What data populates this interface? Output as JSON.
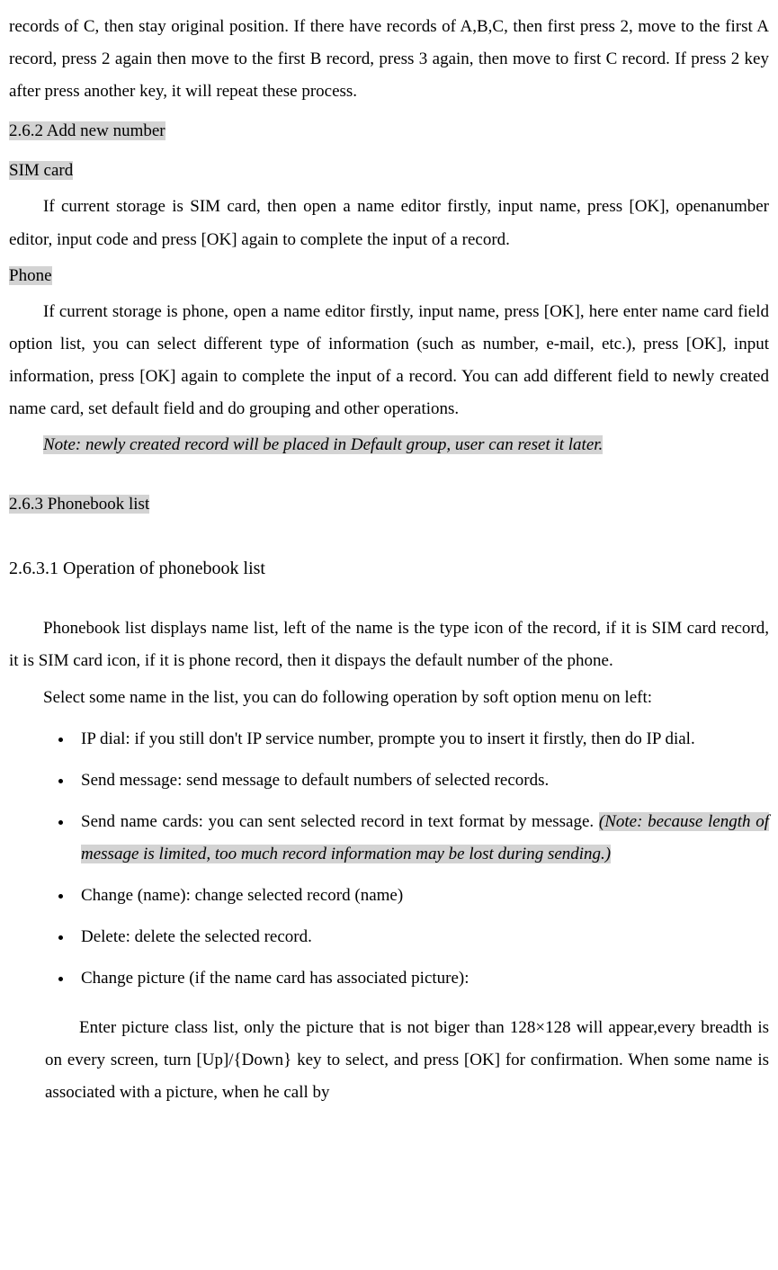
{
  "top_paragraph": "records of C, then stay original position. If there have records of A,B,C, then first press 2, move to the first A record, press 2 again then move to the first B record, press 3 again, then move to first C record. If press 2 key after press another key, it will repeat these process.",
  "sec262": {
    "heading": "2.6.2 Add new number",
    "sim_label": "SIM card",
    "sim_text": "If current storage is SIM card, then open a name editor firstly, input name, press [OK], openanumber editor, input code and press [OK] again to complete the input of a record.",
    "phone_label": "Phone",
    "phone_text": "If current storage is phone, open a name editor firstly, input name, press [OK], here enter name card field option list, you can select different type of information (such as number, e-mail, etc.), press [OK], input information, press [OK] again to complete the input of a record. You can add different field to newly created name card, set default field and do grouping and other operations.",
    "note": "Note: newly created record will be placed in Default group, user can reset it later."
  },
  "sec263": {
    "heading": "2.6.3 Phonebook list",
    "sub_heading": "2.6.3.1 Operation of phonebook list",
    "intro": "Phonebook list displays name list, left of the name is the type icon of the record, if it is SIM card record, it is SIM card icon, if it is phone record, then it dispays the default number of the phone.",
    "select_text": "Select some name in the list, you can do following operation by soft option menu on left:",
    "bullets": {
      "ip_dial": "IP dial: if you still don't IP service number, prompte you to insert it firstly, then do IP dial.",
      "send_message": "Send message: send message to default numbers of selected records.",
      "send_cards_prefix": "Send name cards: you can sent selected record in text format by message. ",
      "send_cards_note": "(Note: because length of message is limited, too much record information may be lost during sending.) ",
      "change_name": "Change (name): change selected record (name)",
      "delete": "Delete: delete the selected record.",
      "change_picture": "Change picture (if the name card has associated picture):"
    },
    "picture_detail": "Enter picture class list, only the picture that is not biger than 128×128 will appear,every breadth is on every screen, turn [Up]/{Down} key to select, and press [OK] for confirmation. When some name is associated with a picture, when he call by"
  }
}
